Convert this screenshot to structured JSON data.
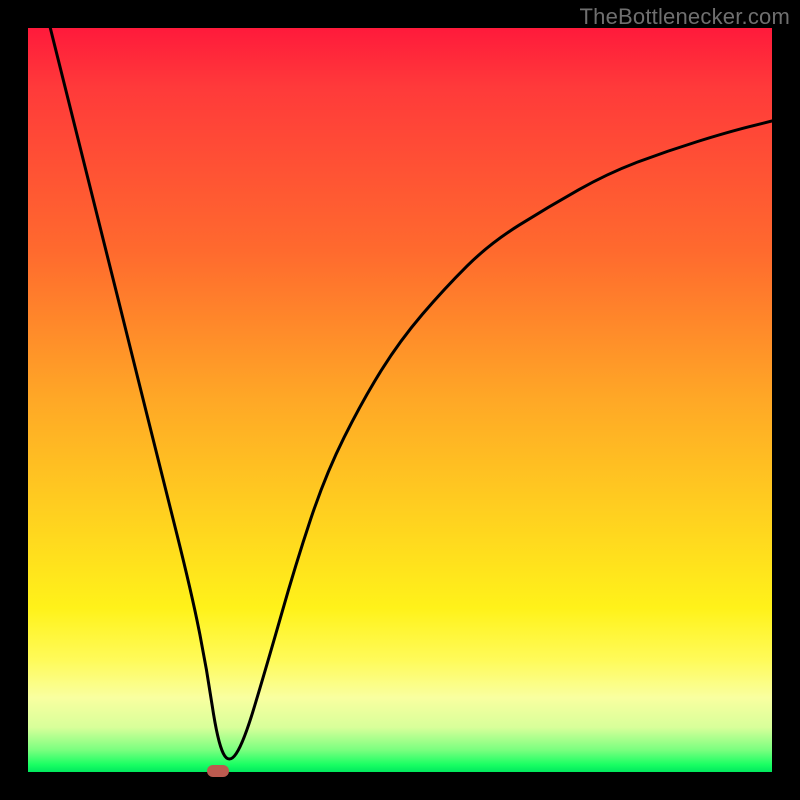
{
  "watermark": "TheBottlenecker.com",
  "colors": {
    "frame": "#000000",
    "gradient_start": "#ff1a3b",
    "gradient_end": "#00e85e",
    "curve": "#000000",
    "marker": "#bb5a4f",
    "watermark_text": "#6f6f6f"
  },
  "chart_data": {
    "type": "line",
    "title": "",
    "xlabel": "",
    "ylabel": "",
    "xlim": [
      0,
      100
    ],
    "ylim": [
      0,
      100
    ],
    "series": [
      {
        "name": "bottleneck_curve",
        "x": [
          3,
          6,
          10,
          14,
          18,
          22,
          24,
          25.5,
          27,
          29,
          32,
          36,
          40,
          45,
          50,
          56,
          62,
          70,
          78,
          86,
          94,
          100
        ],
        "y": [
          100,
          88,
          72,
          56,
          40,
          24,
          14,
          4,
          1,
          4,
          14,
          28,
          40,
          50,
          58,
          65,
          71,
          76,
          80.5,
          83.5,
          86,
          87.5
        ]
      }
    ],
    "marker": {
      "x": 25.5,
      "y": 0.2,
      "shape": "rounded-rect"
    },
    "legend": false,
    "grid": false
  }
}
